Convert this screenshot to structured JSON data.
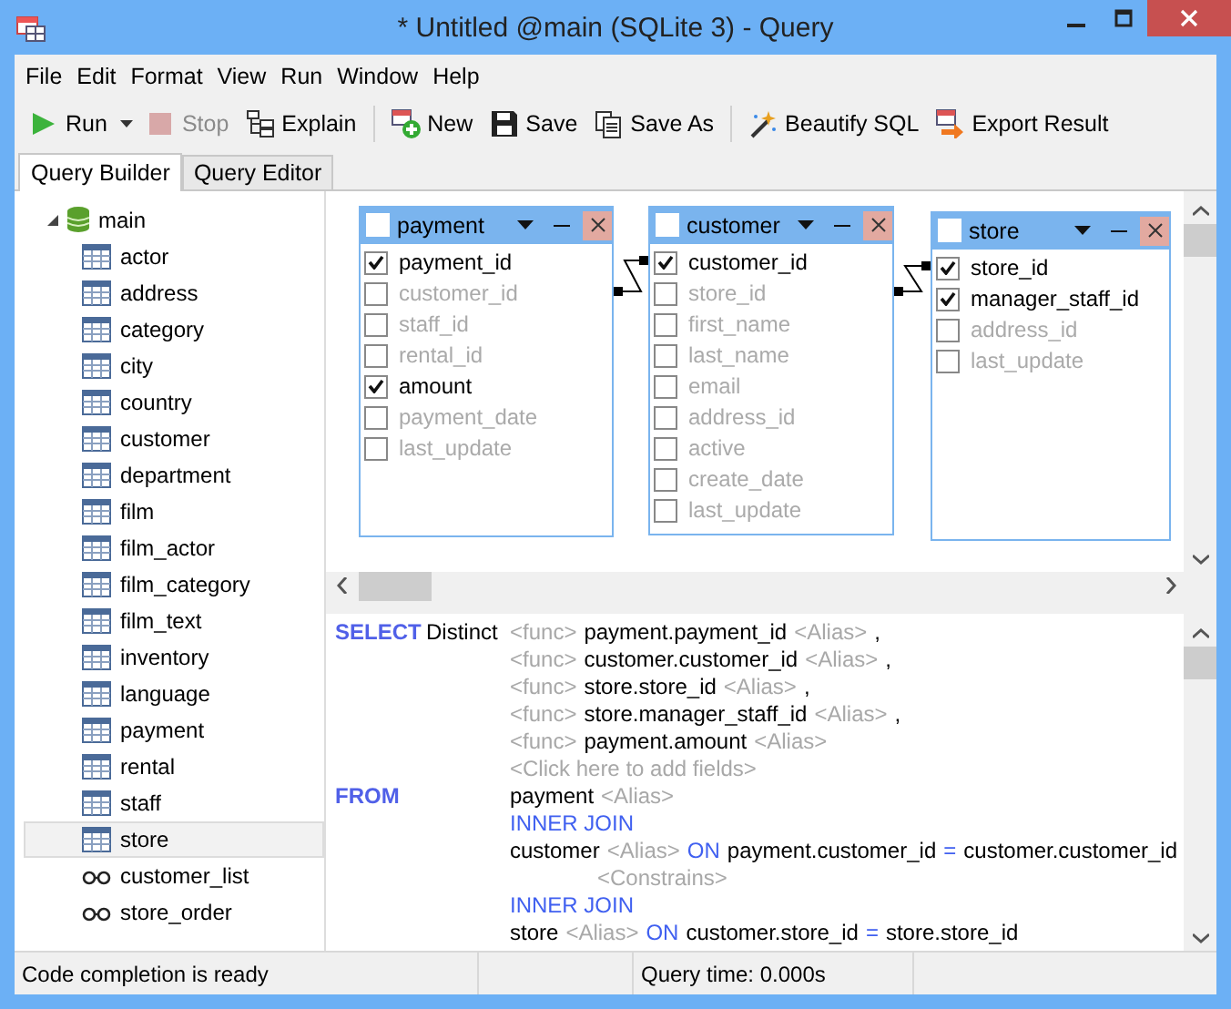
{
  "window": {
    "title": "* Untitled @main (SQLite 3) - Query"
  },
  "menu": [
    "File",
    "Edit",
    "Format",
    "View",
    "Run",
    "Window",
    "Help"
  ],
  "toolbar": [
    {
      "kind": "split",
      "label": "Run",
      "disabled": false
    },
    {
      "kind": "button",
      "label": "Stop",
      "disabled": true
    },
    {
      "kind": "button",
      "label": "Explain",
      "disabled": false
    },
    {
      "kind": "separator"
    },
    {
      "kind": "button",
      "label": "New",
      "disabled": false
    },
    {
      "kind": "button",
      "label": "Save",
      "disabled": false
    },
    {
      "kind": "button",
      "label": "Save As",
      "disabled": false
    },
    {
      "kind": "separator"
    },
    {
      "kind": "button",
      "label": "Beautify SQL",
      "disabled": false
    },
    {
      "kind": "button",
      "label": "Export Result",
      "disabled": false
    }
  ],
  "tabs": [
    {
      "label": "Query Builder",
      "selected": true
    },
    {
      "label": "Query Editor",
      "selected": false
    }
  ],
  "tree": {
    "label": "main",
    "expanded": true,
    "children": [
      {
        "label": "actor",
        "kind": "table",
        "selected": false
      },
      {
        "label": "address",
        "kind": "table",
        "selected": false
      },
      {
        "label": "category",
        "kind": "table",
        "selected": false
      },
      {
        "label": "city",
        "kind": "table",
        "selected": false
      },
      {
        "label": "country",
        "kind": "table",
        "selected": false
      },
      {
        "label": "customer",
        "kind": "table",
        "selected": false
      },
      {
        "label": "department",
        "kind": "table",
        "selected": false
      },
      {
        "label": "film",
        "kind": "table",
        "selected": false
      },
      {
        "label": "film_actor",
        "kind": "table",
        "selected": false
      },
      {
        "label": "film_category",
        "kind": "table",
        "selected": false
      },
      {
        "label": "film_text",
        "kind": "table",
        "selected": false
      },
      {
        "label": "inventory",
        "kind": "table",
        "selected": false
      },
      {
        "label": "language",
        "kind": "table",
        "selected": false
      },
      {
        "label": "payment",
        "kind": "table",
        "selected": false
      },
      {
        "label": "rental",
        "kind": "table",
        "selected": false
      },
      {
        "label": "staff",
        "kind": "table",
        "selected": false
      },
      {
        "label": "store",
        "kind": "table",
        "selected": true
      },
      {
        "label": "customer_list",
        "kind": "view",
        "selected": false
      },
      {
        "label": "store_order",
        "kind": "view",
        "selected": false
      }
    ]
  },
  "designer": {
    "tables": [
      {
        "name": "payment",
        "all_checked": false,
        "columns": [
          {
            "name": "payment_id",
            "checked": true
          },
          {
            "name": "customer_id",
            "checked": false,
            "link_out": true
          },
          {
            "name": "staff_id",
            "checked": false
          },
          {
            "name": "rental_id",
            "checked": false
          },
          {
            "name": "amount",
            "checked": true
          },
          {
            "name": "payment_date",
            "checked": false
          },
          {
            "name": "last_update",
            "checked": false
          }
        ]
      },
      {
        "name": "customer",
        "all_checked": false,
        "columns": [
          {
            "name": "customer_id",
            "checked": true,
            "link_in": true
          },
          {
            "name": "store_id",
            "checked": false,
            "link_out": true
          },
          {
            "name": "first_name",
            "checked": false
          },
          {
            "name": "last_name",
            "checked": false
          },
          {
            "name": "email",
            "checked": false
          },
          {
            "name": "address_id",
            "checked": false
          },
          {
            "name": "active",
            "checked": false
          },
          {
            "name": "create_date",
            "checked": false
          },
          {
            "name": "last_update",
            "checked": false
          }
        ]
      },
      {
        "name": "store",
        "all_checked": false,
        "columns": [
          {
            "name": "store_id",
            "checked": true,
            "link_in": true
          },
          {
            "name": "manager_staff_id",
            "checked": true
          },
          {
            "name": "address_id",
            "checked": false
          },
          {
            "name": "last_update",
            "checked": false
          }
        ]
      }
    ]
  },
  "sql": [
    {
      "kind": "item",
      "clause": "SELECT",
      "modifier": "Distinct",
      "tokens": [
        {
          "kind": "hint",
          "text": "<func>"
        },
        {
          "kind": "field",
          "text": "payment.payment_id"
        },
        {
          "kind": "hint",
          "text": "<Alias>"
        },
        {
          "kind": "plain",
          "text": ","
        }
      ]
    },
    {
      "kind": "item",
      "tokens": [
        {
          "kind": "hint",
          "text": "<func>"
        },
        {
          "kind": "field",
          "text": "customer.customer_id"
        },
        {
          "kind": "hint",
          "text": "<Alias>"
        },
        {
          "kind": "plain",
          "text": ","
        }
      ]
    },
    {
      "kind": "item",
      "tokens": [
        {
          "kind": "hint",
          "text": "<func>"
        },
        {
          "kind": "field",
          "text": "store.store_id"
        },
        {
          "kind": "hint",
          "text": "<Alias>"
        },
        {
          "kind": "plain",
          "text": ","
        }
      ]
    },
    {
      "kind": "item",
      "tokens": [
        {
          "kind": "hint",
          "text": "<func>"
        },
        {
          "kind": "field",
          "text": "store.manager_staff_id"
        },
        {
          "kind": "hint",
          "text": "<Alias>"
        },
        {
          "kind": "plain",
          "text": ","
        }
      ]
    },
    {
      "kind": "item",
      "tokens": [
        {
          "kind": "hint",
          "text": "<func>"
        },
        {
          "kind": "field",
          "text": "payment.amount"
        },
        {
          "kind": "hint",
          "text": "<Alias>"
        }
      ]
    },
    {
      "kind": "item",
      "tokens": [
        {
          "kind": "hint",
          "text": "<Click here to add fields>"
        }
      ]
    },
    {
      "kind": "item",
      "clause": "FROM",
      "tokens": [
        {
          "kind": "field",
          "text": "payment"
        },
        {
          "kind": "hint",
          "text": "<Alias>"
        }
      ]
    },
    {
      "kind": "item",
      "tokens": [
        {
          "kind": "keyword",
          "text": "INNER JOIN"
        }
      ]
    },
    {
      "kind": "item",
      "tokens": [
        {
          "kind": "field",
          "text": "customer"
        },
        {
          "kind": "hint",
          "text": "<Alias>"
        },
        {
          "kind": "keyword",
          "text": "ON"
        },
        {
          "kind": "field",
          "text": "payment.customer_id"
        },
        {
          "kind": "keyword",
          "text": "="
        },
        {
          "kind": "field",
          "text": "customer.customer_id"
        }
      ]
    },
    {
      "kind": "constraint",
      "tokens": [
        {
          "kind": "hint",
          "text": "<Constrains>"
        }
      ]
    },
    {
      "kind": "item",
      "tokens": [
        {
          "kind": "keyword",
          "text": "INNER JOIN"
        }
      ]
    },
    {
      "kind": "item",
      "tokens": [
        {
          "kind": "field",
          "text": "store"
        },
        {
          "kind": "hint",
          "text": "<Alias>"
        },
        {
          "kind": "keyword",
          "text": "ON"
        },
        {
          "kind": "field",
          "text": "customer.store_id"
        },
        {
          "kind": "keyword",
          "text": "="
        },
        {
          "kind": "field",
          "text": "store.store_id"
        }
      ]
    }
  ],
  "status_bar": {
    "message": "Code completion is ready",
    "query_time": "Query time: 0.000s"
  }
}
